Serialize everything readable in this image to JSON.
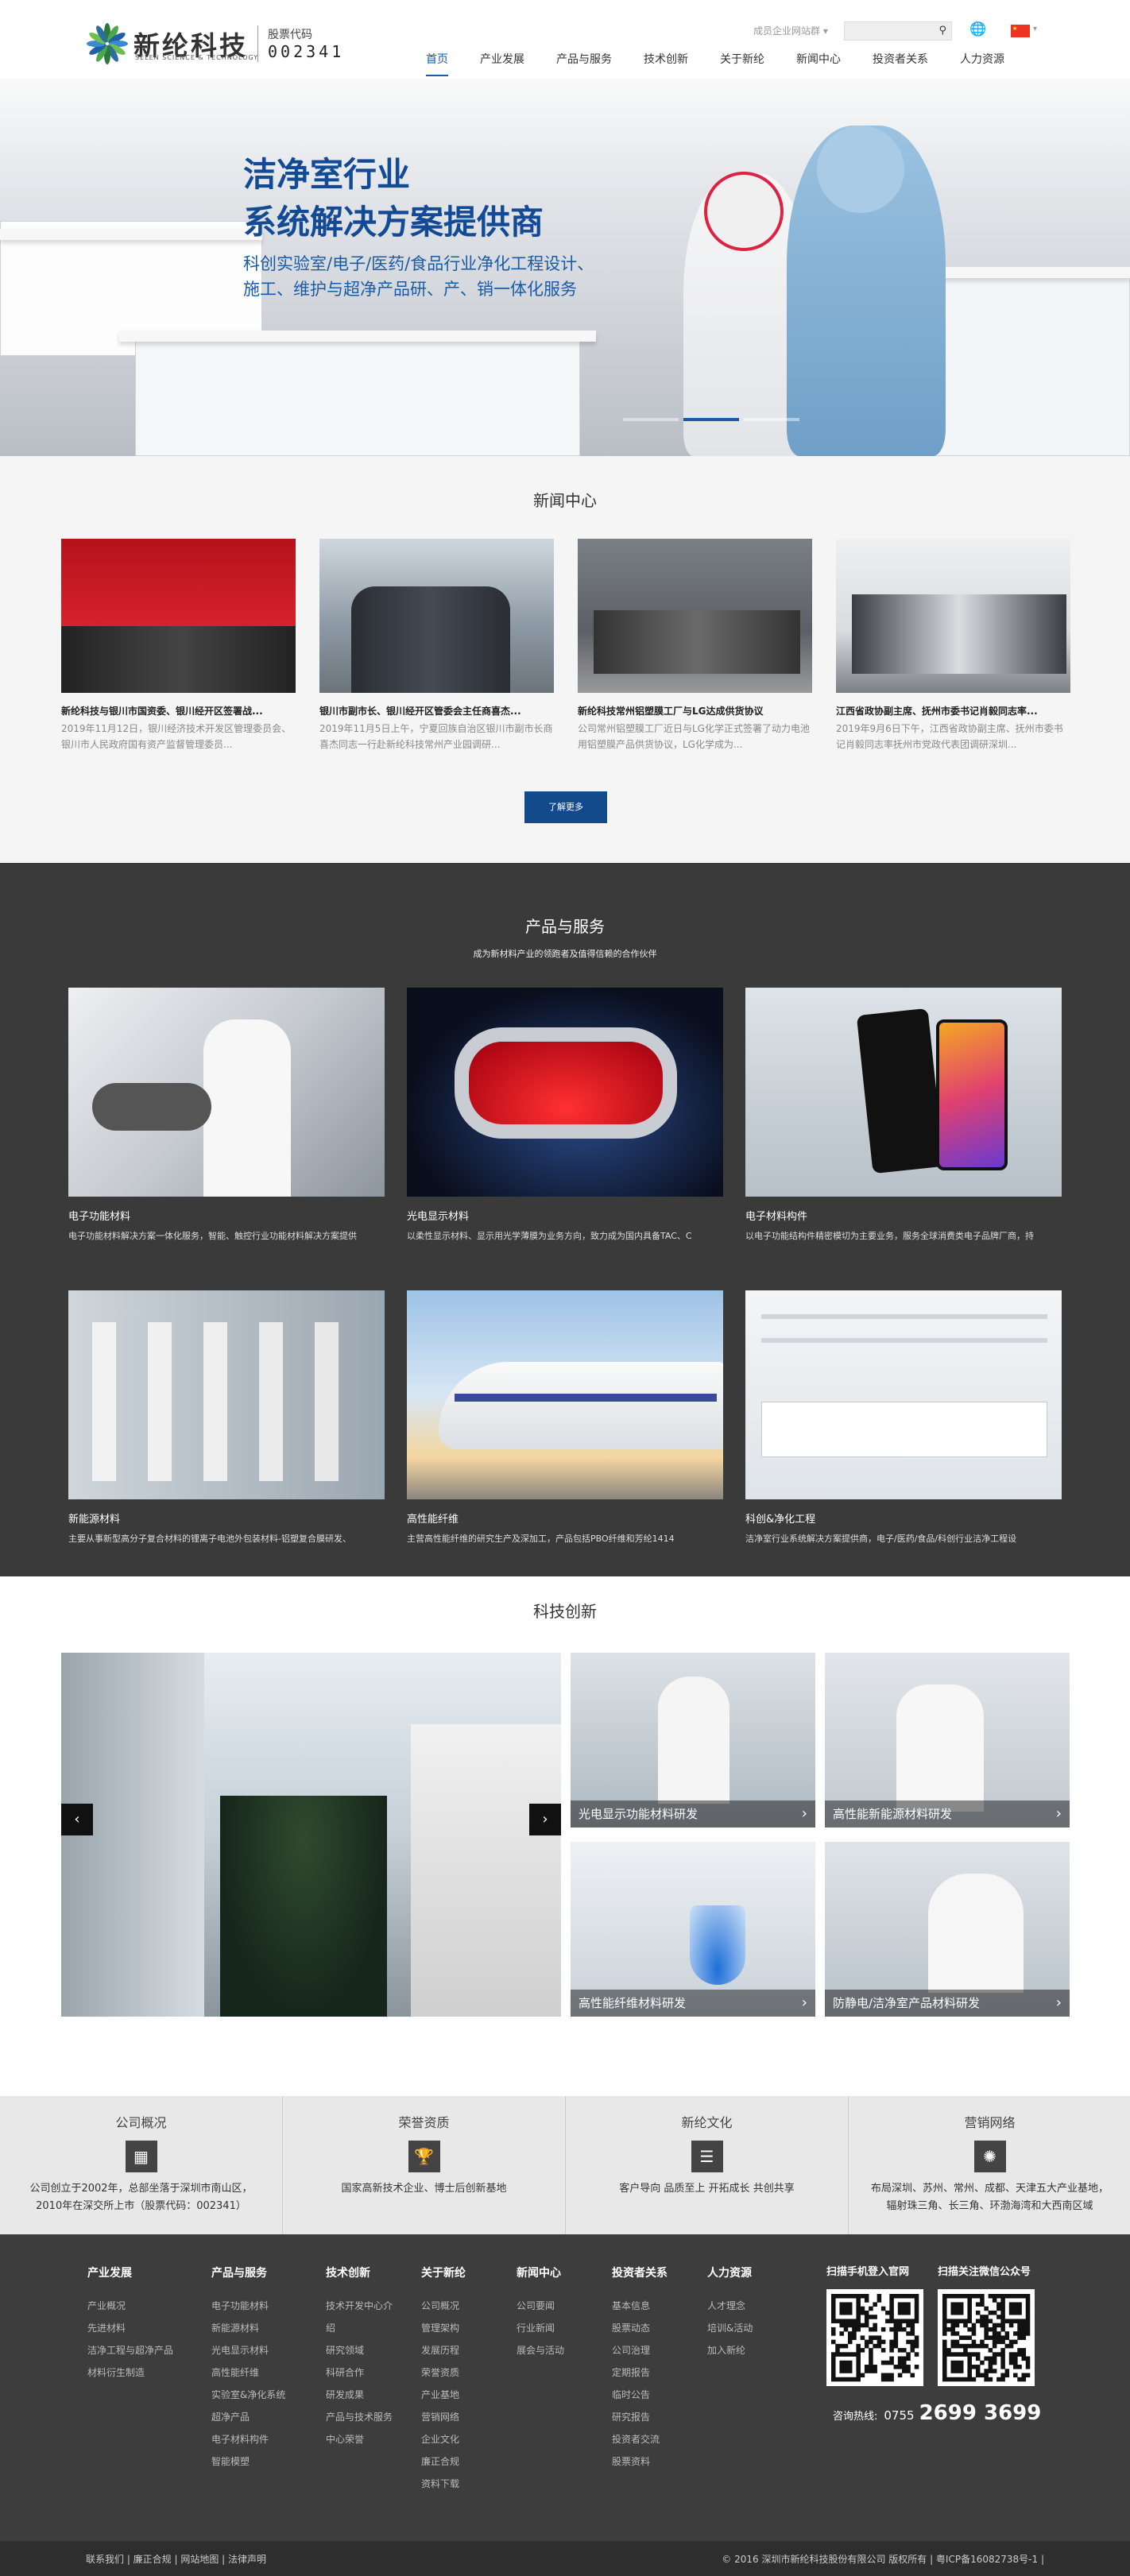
{
  "header": {
    "logo_cn": "新纶科技",
    "logo_en": "SELEN SCIENCE & TECHNOLOGY",
    "stock_label": "股票代码",
    "stock_code": "002341",
    "member_login": "成员企业网站群 ▾",
    "nav": [
      "首页",
      "产业发展",
      "产品与服务",
      "技术创新",
      "关于新纶",
      "新闻中心",
      "投资者关系",
      "人力资源"
    ],
    "active_nav": 0
  },
  "banner": {
    "title_line1": "洁净室行业",
    "title_line2": "系统解决方案提供商",
    "sub_line1": "科创实验室/电子/医药/食品行业净化工程设计、",
    "sub_line2": "施工、维护与超净产品研、产、销一体化服务",
    "slides": 3,
    "active_slide": 1
  },
  "news": {
    "title": "新闻中心",
    "more_label": "了解更多",
    "items": [
      {
        "title": "新纶科技与银川市国资委、银川经开区签署战...",
        "summary": "2019年11月12日，银川经济技术开发区管理委员会、银川市人民政府国有资产监督管理委员..."
      },
      {
        "title": "银川市副市长、银川经开区管委会主任商喜杰...",
        "summary": "2019年11月5日上午，宁夏回族自治区银川市副市长商喜杰同志一行赴新纶科技常州产业园调研..."
      },
      {
        "title": "新纶科技常州铝塑膜工厂与LG达成供货协议",
        "summary": "公司常州铝塑膜工厂近日与LG化学正式签署了动力电池用铝塑膜产品供货协议，LG化学成为..."
      },
      {
        "title": "江西省政协副主席、抚州市委书记肖毅同志率...",
        "summary": "2019年9月6日下午，江西省政协副主席、抚州市委书记肖毅同志率抚州市党政代表团调研深圳..."
      }
    ]
  },
  "products": {
    "title": "产品与服务",
    "subtitle": "成为新材料产业的领跑者及值得信赖的合作伙伴",
    "items": [
      {
        "name": "电子功能材料",
        "desc": "电子功能材料解决方案一体化服务，智能、触控行业功能材料解决方案提供"
      },
      {
        "name": "光电显示材料",
        "desc": "以柔性显示材料、显示用光学薄膜为业务方向，致力成为国内具备TAC、C"
      },
      {
        "name": "电子材料构件",
        "desc": "以电子功能结构件精密模切为主要业务，服务全球消费类电子品牌厂商，持"
      },
      {
        "name": "新能源材料",
        "desc": "主要从事新型高分子复合材料的锂离子电池外包装材料-铝塑复合膜研发、"
      },
      {
        "name": "高性能纤维",
        "desc": "主营高性能纤维的研究生产及深加工，产品包括PBO纤维和芳纶1414"
      },
      {
        "name": "科创&净化工程",
        "desc": "洁净室行业系统解决方案提供商，电子/医药/食品/科创行业洁净工程设"
      }
    ]
  },
  "tech": {
    "title": "科技创新",
    "prev": "‹",
    "next": "›",
    "items": [
      "光电显示功能材料研发",
      "高性能新能源材料研发",
      "高性能纤维材料研发",
      "防静电/洁净室产品材料研发"
    ]
  },
  "overview": [
    {
      "title": "公司概况",
      "icon": "building-icon",
      "text1": "公司创立于2002年，总部坐落于深圳市南山区，",
      "text2": "2010年在深交所上市（股票代码：002341）"
    },
    {
      "title": "荣誉资质",
      "icon": "trophy-icon",
      "text1": "国家高新技术企业、博士后创新基地",
      "text2": ""
    },
    {
      "title": "新纶文化",
      "icon": "book-icon",
      "text1": "客户导向 品质至上 开拓成长 共创共享",
      "text2": ""
    },
    {
      "title": "营销网络",
      "icon": "network-icon",
      "text1": "布局深圳、苏州、常州、成都、天津五大产业基地，",
      "text2": "辐射珠三角、长三角、环渤海湾和大西南区域"
    }
  ],
  "footer": {
    "columns": [
      {
        "title": "产业发展",
        "links": [
          "产业概况",
          "先进材料",
          "洁净工程与超净产品",
          "材料衍生制造"
        ]
      },
      {
        "title": "产品与服务",
        "links": [
          "电子功能材料",
          "新能源材料",
          "光电显示材料",
          "高性能纤维",
          "实验室&净化系统",
          "超净产品",
          "电子材料构件",
          "智能模塑"
        ]
      },
      {
        "title": "技术创新",
        "links": [
          "技术开发中心介",
          "绍",
          "研究领域",
          "科研合作",
          "研发成果",
          "产品与技术服务",
          "中心荣誉"
        ]
      },
      {
        "title": "关于新纶",
        "links": [
          "公司概况",
          "管理架构",
          "发展历程",
          "荣誉资质",
          "产业基地",
          "营销网络",
          "企业文化",
          "廉正合规",
          "资料下载"
        ]
      },
      {
        "title": "新闻中心",
        "links": [
          "公司要闻",
          "行业新闻",
          "展会与活动"
        ]
      },
      {
        "title": "投资者关系",
        "links": [
          "基本信息",
          "股票动态",
          "公司治理",
          "定期报告",
          "临时公告",
          "研究报告",
          "投资者交流",
          "股票资料"
        ]
      },
      {
        "title": "人力资源",
        "links": [
          "人才理念",
          "培训&活动",
          "加入新纶"
        ]
      }
    ],
    "qr_site_label": "扫描手机登入官网",
    "qr_wechat_label": "扫描关注微信公众号",
    "hotline_label": "咨询热线:",
    "hotline_prefix": "0755",
    "hotline_number": "2699 3699",
    "bottom_links": "联系我们 | 廉正合规 | 网站地图 | 法律声明",
    "copyright": "© 2016 深圳市新纶科技股份有限公司 版权所有 | 粤ICP备16082738号-1 |"
  }
}
